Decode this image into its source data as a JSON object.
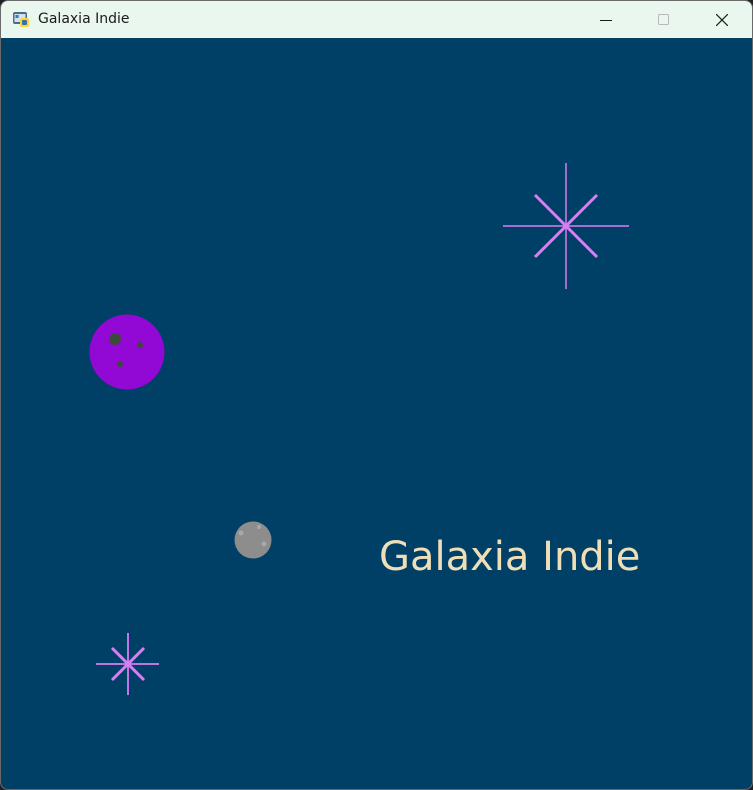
{
  "window": {
    "title": "Galaxia Indie",
    "icon": "python-app-icon",
    "controls": [
      "minimize",
      "maximize",
      "close"
    ]
  },
  "game": {
    "background_color": "#003f66",
    "title_text": "Galaxia Indie",
    "title_color": "#efdfb8",
    "star_color": "#d97df5",
    "planet_color": "#9208d4",
    "moon_color": "#8d8d8d"
  }
}
